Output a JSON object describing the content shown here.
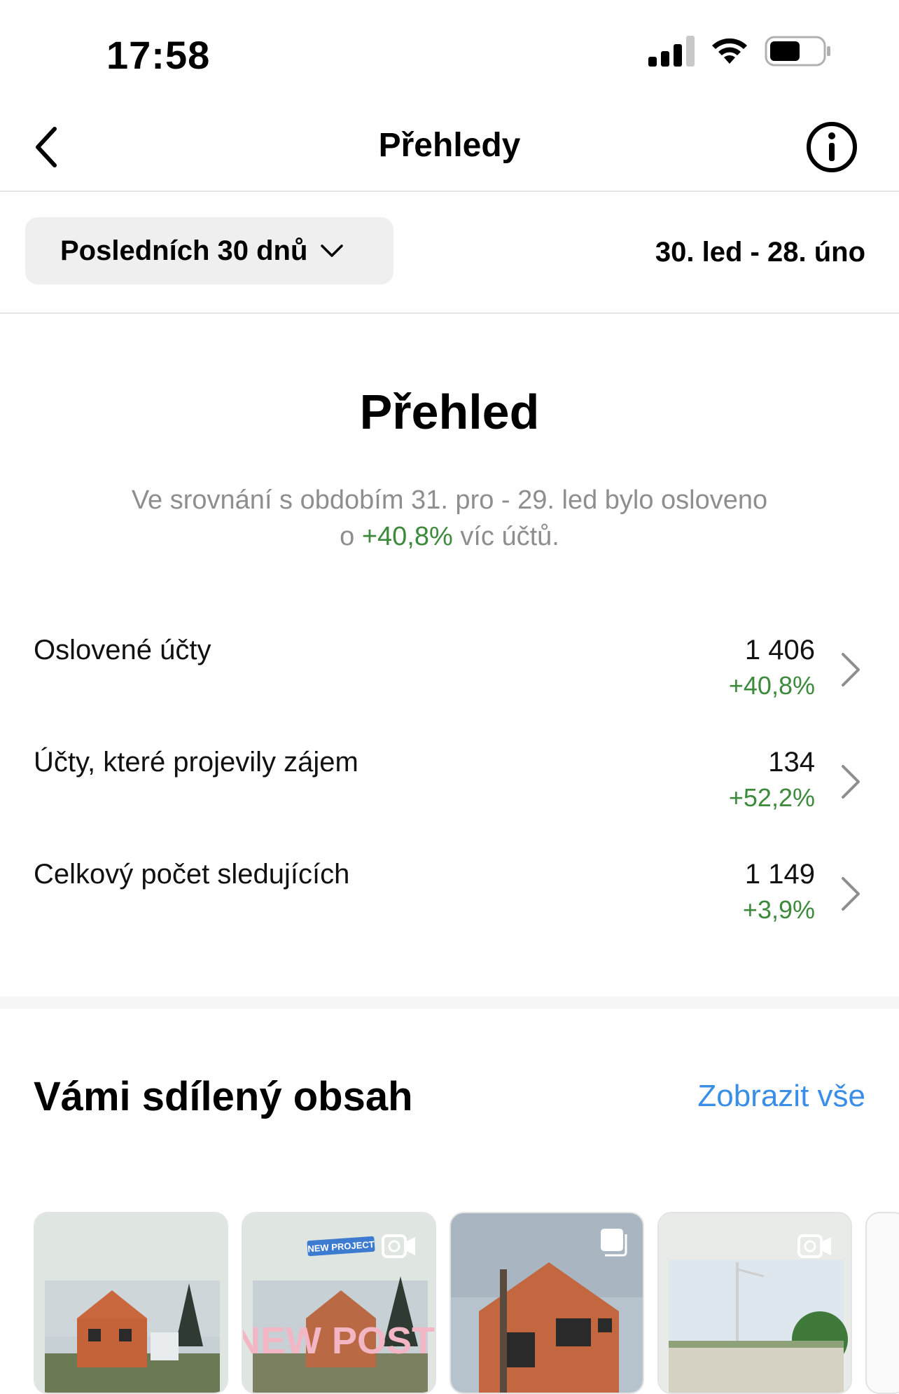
{
  "status_bar": {
    "time": "17:58",
    "icons": [
      "cellular-signal-icon",
      "wifi-icon",
      "battery-icon"
    ]
  },
  "nav": {
    "title": "Přehledy",
    "back_icon": "chevron-left-icon",
    "info_icon": "info-icon"
  },
  "filter": {
    "period_label": "Posledních 30 dnů",
    "date_range": "30. led - 28. úno"
  },
  "overview": {
    "title": "Přehled",
    "desc_part1": "Ve srovnání s obdobím 31. pro - 29. led bylo osloveno",
    "desc_part2_prefix": "o ",
    "desc_highlight": "+40,8%",
    "desc_part2_suffix": " víc účtů."
  },
  "metrics": [
    {
      "label": "Oslovené účty",
      "value": "1 406",
      "change": "+40,8%"
    },
    {
      "label": "Účty, které projevily zájem",
      "value": "134",
      "change": "+52,2%"
    },
    {
      "label": "Celkový počet sledujících",
      "value": "1 149",
      "change": "+3,9%"
    }
  ],
  "content": {
    "title": "Vámi sdílený obsah",
    "see_all": "Zobrazit vše",
    "thumbnails": [
      {
        "name": "post-thumbnail-house",
        "overlay_icon": ""
      },
      {
        "name": "post-thumbnail-new-post",
        "overlay_icon": "video-camera-icon",
        "badge_text": "NEW PROJECT",
        "poster_text": "NEW POST"
      },
      {
        "name": "post-thumbnail-house-closeup",
        "overlay_icon": "carousel-icon"
      },
      {
        "name": "post-thumbnail-construction-site",
        "overlay_icon": "video-camera-icon"
      }
    ]
  },
  "colors": {
    "positive": "#3d8a3d",
    "link": "#3a8ee6",
    "secondary_text": "#8e8e8e",
    "button_bg": "#efefef"
  }
}
